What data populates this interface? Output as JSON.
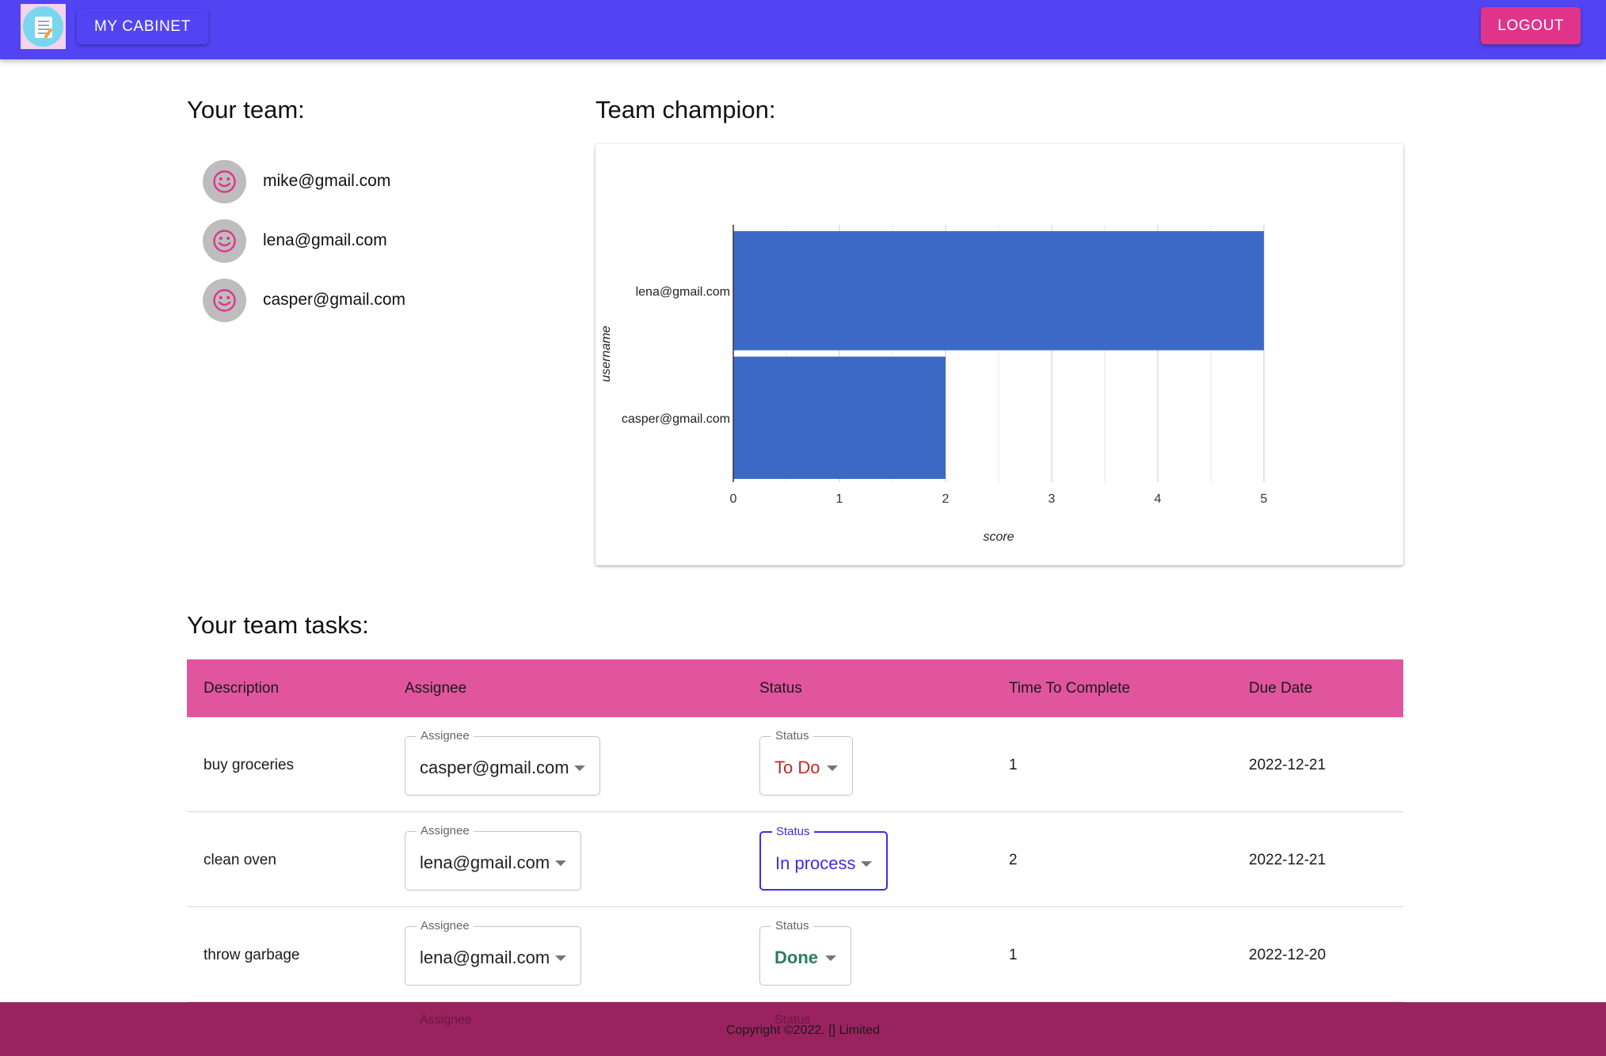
{
  "header": {
    "nav_label": "MY CABINET",
    "logout_label": "LOGOUT",
    "colors": {
      "bar": "#5344f3",
      "logout": "#e0348b"
    }
  },
  "team": {
    "heading": "Your team:",
    "members": [
      "mike@gmail.com",
      "lena@gmail.com",
      "casper@gmail.com"
    ],
    "avatar_icon": "smiley-face-icon"
  },
  "champion": {
    "heading": "Team champion:"
  },
  "chart_data": {
    "type": "bar",
    "orientation": "horizontal",
    "categories": [
      "lena@gmail.com",
      "casper@gmail.com"
    ],
    "values": [
      5,
      2
    ],
    "xlabel": "score",
    "ylabel": "username",
    "xlim": [
      0,
      5
    ],
    "xticks": [
      "0",
      "1",
      "2",
      "3",
      "4",
      "5"
    ],
    "grid": true,
    "bar_color": "#3d69c6"
  },
  "tasks": {
    "heading": "Your team tasks:",
    "columns": [
      "Description",
      "Assignee",
      "Status",
      "Time To Complete",
      "Due Date"
    ],
    "assignee_legend": "Assignee",
    "status_legend": "Status",
    "rows": [
      {
        "description": "buy groceries",
        "assignee": "casper@gmail.com",
        "status": "To Do",
        "time": "1",
        "due": "2022-12-21"
      },
      {
        "description": "clean oven",
        "assignee": "lena@gmail.com",
        "status": "In process",
        "time": "2",
        "due": "2022-12-21"
      },
      {
        "description": "throw garbage",
        "assignee": "lena@gmail.com",
        "status": "Done",
        "time": "1",
        "due": "2022-12-20"
      }
    ],
    "status_colors": {
      "To Do": "#c62828",
      "In process": "#3d2ee6",
      "Done": "#2e7d5b"
    },
    "header_color": "#e1559f"
  },
  "footer": {
    "copyright": "Copyright ©2022. [] Limited",
    "overlap_assignee": "Assignee",
    "overlap_status": "Status"
  }
}
